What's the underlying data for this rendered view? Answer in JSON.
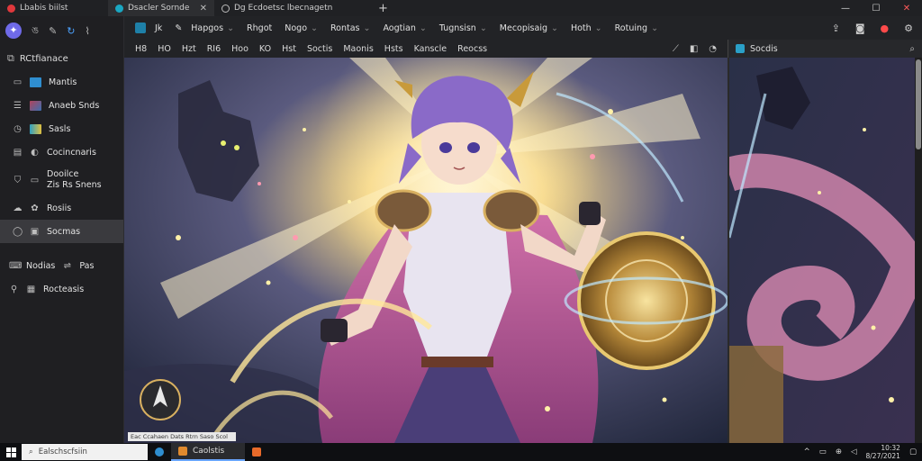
{
  "colors": {
    "accent": "#6f6ae8",
    "tab_bg": "#2d2e31",
    "taskbar": "#0e0f12",
    "close_red": "#ff4a4a"
  },
  "browser": {
    "tabs": [
      {
        "label": "Lbabis biilst",
        "icon": "app-red-icon"
      },
      {
        "label": "Dsacler Sornde",
        "icon": "app-teal-icon"
      },
      {
        "label": "Dg Ecdoetsc lbecnagetn",
        "icon": "globe-icon"
      }
    ],
    "new_tab": "+",
    "window_controls": {
      "minimize": "—",
      "maximize": "☐",
      "close": "✕"
    }
  },
  "sidebar": {
    "top_icons": [
      "spark-icon",
      "bolt-icon",
      "pen-icon",
      "sync-icon",
      "brush-icon"
    ],
    "header": "RCtfianace",
    "items": [
      {
        "label": "Mantis",
        "icon": "frame-icon",
        "thumb": "#2f8ed0"
      },
      {
        "label": "Anaeb Snds",
        "icon": "layers-icon",
        "thumb": "#b0445c"
      },
      {
        "label": "Sasls",
        "icon": "clip-icon",
        "thumb": "#2fa0c2"
      },
      {
        "label": "Cocincnaris",
        "icon": "grid-icon",
        "glyph": "◐"
      },
      {
        "label": "Dooilce",
        "label2": "Zis Rs Snens",
        "icon": "shield-icon",
        "glyph": "▭"
      },
      {
        "label": "Rosiis",
        "icon": "cloud-icon",
        "glyph": "✿"
      },
      {
        "label": "Socmas",
        "icon": "chat-icon",
        "glyph": "◉"
      },
      {
        "label": "Nodias",
        "label2": "Pas",
        "icon": "mail-icon",
        "glyph": "◧"
      },
      {
        "label": "Rocteasis",
        "icon": "pin-icon",
        "glyph": "▦"
      }
    ]
  },
  "toolbar1": {
    "items": [
      {
        "label": "Jk",
        "caret": false
      },
      {
        "label": "Hapgos",
        "caret": true
      },
      {
        "label": "Rhgot",
        "caret": false
      },
      {
        "label": "Nogo",
        "caret": true
      },
      {
        "label": "Rontas",
        "caret": true
      },
      {
        "label": "Aogtian",
        "caret": true
      },
      {
        "label": "Tugnsisn",
        "caret": true
      },
      {
        "label": "Mecopisaig",
        "caret": true
      },
      {
        "label": "Hoth",
        "caret": true
      },
      {
        "label": "Rotuing",
        "caret": true
      }
    ],
    "right_icons": [
      "share-icon",
      "camera-icon",
      "record-icon",
      "settings-icon"
    ]
  },
  "toolbar2": {
    "items": [
      "H8",
      "HO",
      "Hzt",
      "RI6",
      "Hoo",
      "KO",
      "Hst",
      "Soctis",
      "Maonis",
      "Hsts",
      "Kanscle",
      "Reocss"
    ],
    "right_icons": [
      "eyedropper-icon",
      "square-icon",
      "info-icon"
    ]
  },
  "search_panel": {
    "label": "Socdis",
    "search_icon": "search-icon"
  },
  "statusbar": {
    "tip": "Eac Ccahaen Dats Rtrn Saso Scol"
  },
  "taskbar": {
    "search_placeholder": "Ealschscfsiin",
    "apps": [
      {
        "label": "",
        "icon": "edge-icon",
        "color": "#2f8ed0"
      },
      {
        "label": "Caolstis",
        "icon": "folder-icon",
        "color": "#e08a2e"
      },
      {
        "label": "",
        "icon": "store-icon",
        "color": "#e86a2a"
      }
    ],
    "tray_icons": [
      "chevron-up-icon",
      "battery-icon",
      "network-icon",
      "volume-icon"
    ],
    "clock": {
      "time": "10:32",
      "date": "8/27/2021"
    }
  }
}
